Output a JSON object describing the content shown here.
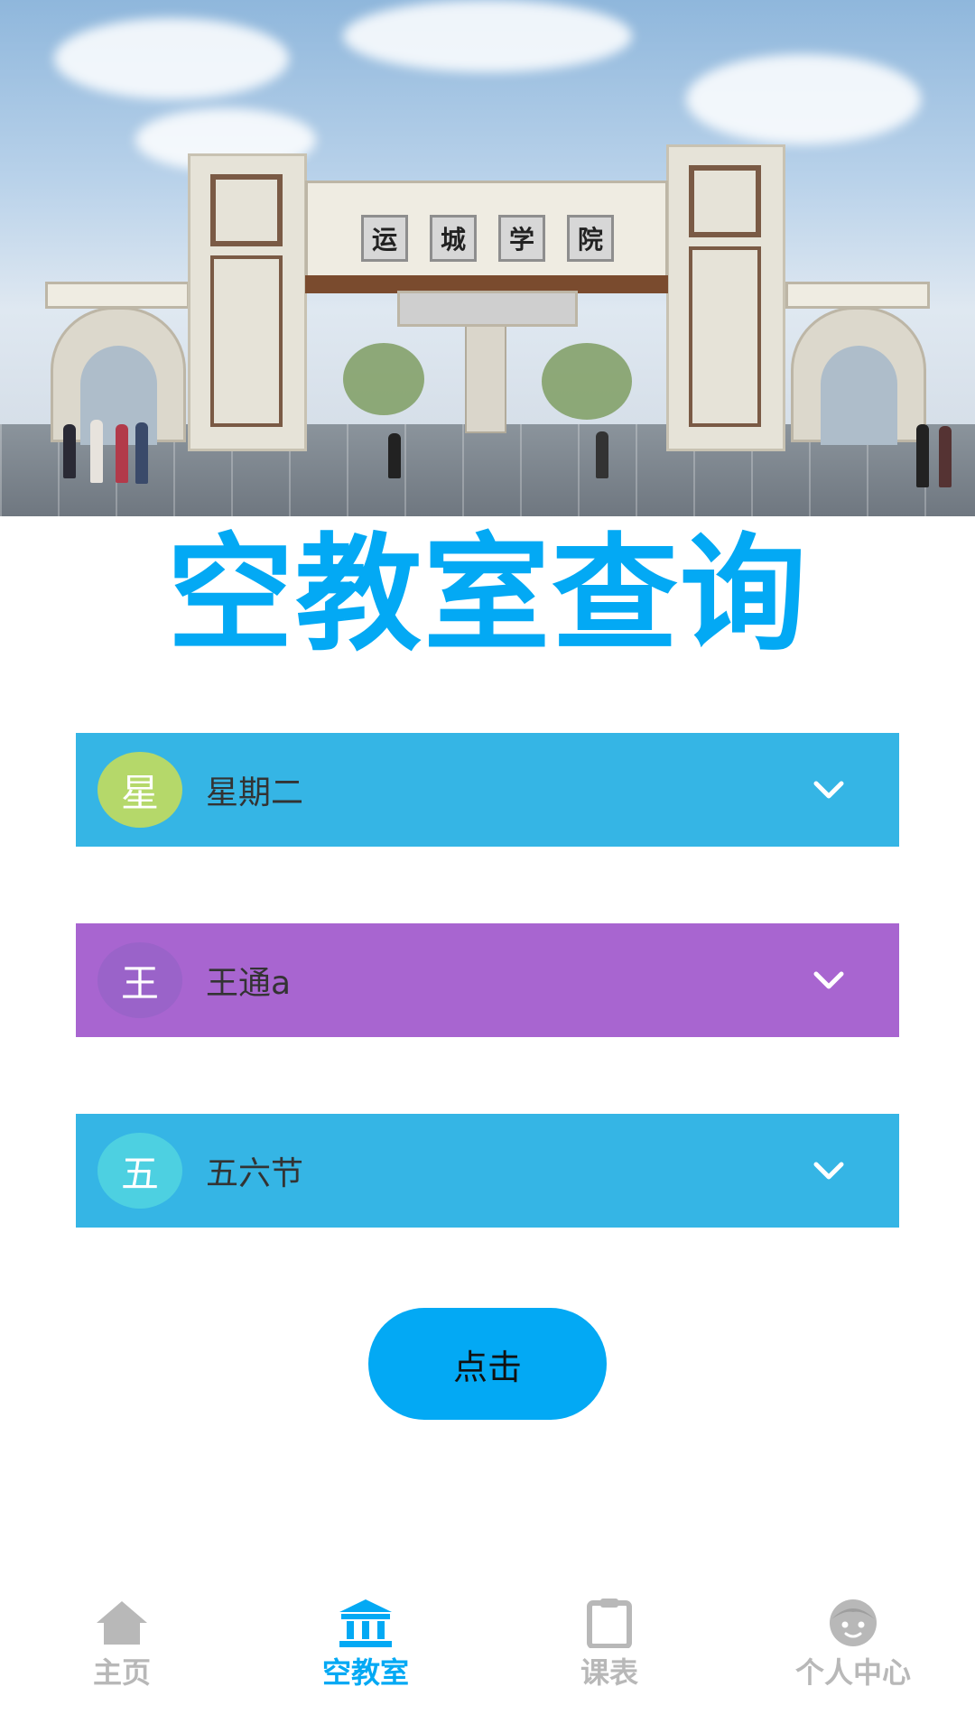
{
  "banner": {
    "sign_chars": [
      "运",
      "城",
      "学",
      "院"
    ]
  },
  "title": "空教室查询",
  "selects": [
    {
      "badge": "星",
      "value": "星期二",
      "row_color": "#35b5e5",
      "badge_color": "#b5d86a"
    },
    {
      "badge": "王",
      "value": "王通a",
      "row_color": "#a865d0",
      "badge_color": "#9a63c9"
    },
    {
      "badge": "五",
      "value": "五六节",
      "row_color": "#35b5e5",
      "badge_color": "#4dd0e1"
    }
  ],
  "action_button": {
    "label": "点击"
  },
  "bottom_nav": {
    "items": [
      {
        "label": "主页",
        "icon": "home-icon",
        "active": false
      },
      {
        "label": "空教室",
        "icon": "building-icon",
        "active": true
      },
      {
        "label": "课表",
        "icon": "clipboard-icon",
        "active": false
      },
      {
        "label": "个人中心",
        "icon": "face-icon",
        "active": false
      }
    ],
    "active_color": "#03a9f4",
    "inactive_color": "#b8b8b8"
  }
}
